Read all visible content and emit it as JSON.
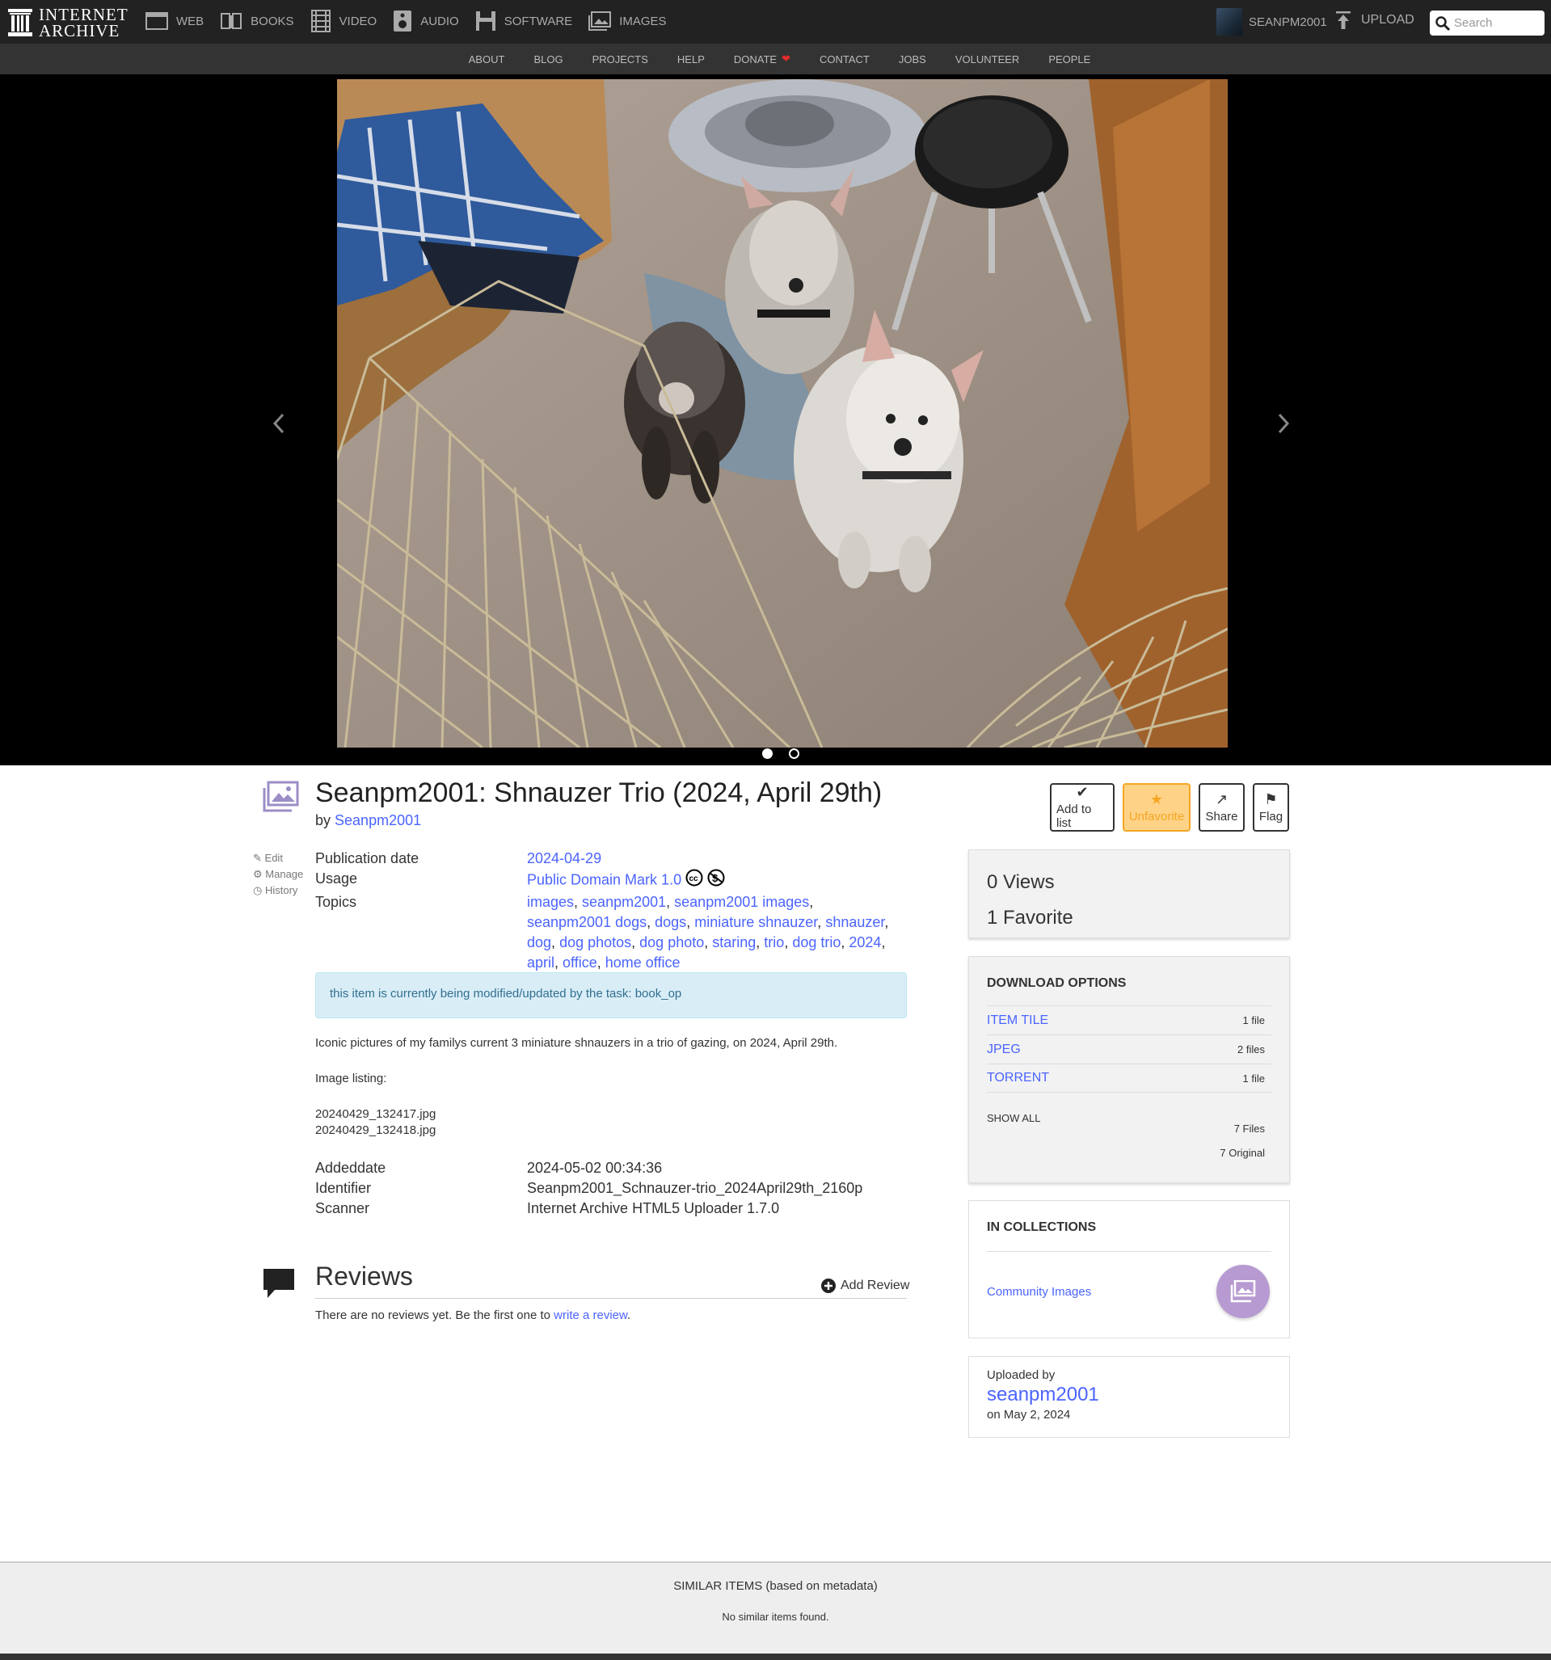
{
  "topbar": {
    "logo_line1": "INTERNET",
    "logo_line2": "ARCHIVE",
    "media": [
      {
        "label": "WEB",
        "icon": "web-icon"
      },
      {
        "label": "BOOKS",
        "icon": "books-icon"
      },
      {
        "label": "VIDEO",
        "icon": "video-icon"
      },
      {
        "label": "AUDIO",
        "icon": "audio-icon"
      },
      {
        "label": "SOFTWARE",
        "icon": "software-icon"
      },
      {
        "label": "IMAGES",
        "icon": "images-icon"
      }
    ],
    "username": "SEANPM2001",
    "upload_label": "UPLOAD",
    "search_placeholder": "Search"
  },
  "subnav": {
    "items": [
      "ABOUT",
      "BLOG",
      "PROJECTS",
      "HELP",
      "DONATE",
      "CONTACT",
      "JOBS",
      "VOLUNTEER",
      "PEOPLE"
    ]
  },
  "theatre": {
    "slide_count": 2,
    "active_slide": 1
  },
  "item": {
    "title": "Seanpm2001: Shnauzer Trio (2024, April 29th)",
    "by_prefix": "by",
    "creator": "Seanpm2001"
  },
  "actions": {
    "add_to_list": "Add to list",
    "unfavorite": "Unfavorite",
    "share": "Share",
    "flag": "Flag"
  },
  "tools": {
    "edit": "Edit",
    "manage": "Manage",
    "history": "History"
  },
  "metadata": {
    "publication_date_label": "Publication date",
    "publication_date": "2024-04-29",
    "usage_label": "Usage",
    "usage": "Public Domain Mark 1.0",
    "topics_label": "Topics",
    "topics": [
      "images",
      "seanpm2001",
      "seanpm2001 images",
      "seanpm2001 dogs",
      "dogs",
      "miniature shnauzer",
      "shnauzer",
      "dog",
      "dog photos",
      "dog photo",
      "staring",
      "trio",
      "dog trio",
      "2024",
      "april",
      "office",
      "home office"
    ],
    "notice": "this item is currently being modified/updated by the task: ",
    "notice_task": "book_op",
    "description": "Iconic pictures of my familys current 3 miniature shnauzers in a trio of gazing, on 2024, April 29th.",
    "image_listing_label": "Image listing:",
    "files": [
      "20240429_132417.jpg",
      "20240429_132418.jpg"
    ],
    "addeddate_label": "Addeddate",
    "addeddate": "2024-05-02 00:34:36",
    "identifier_label": "Identifier",
    "identifier": "Seanpm2001_Schnauzer-trio_2024April29th_2160p",
    "scanner_label": "Scanner",
    "scanner": "Internet Archive HTML5 Uploader 1.7.0"
  },
  "reviews": {
    "title": "Reviews",
    "add_label": "Add Review",
    "empty_text": "There are no reviews yet. Be the first one to ",
    "write_link": "write a review",
    "empty_end": "."
  },
  "stats": {
    "views": "0 Views",
    "favorites": "1 Favorite"
  },
  "downloads": {
    "title": "DOWNLOAD OPTIONS",
    "rows": [
      {
        "label": "ITEM TILE",
        "count": "1 file"
      },
      {
        "label": "JPEG",
        "count": "2 files"
      },
      {
        "label": "TORRENT",
        "count": "1 file"
      }
    ],
    "show_all": "SHOW ALL",
    "total_files": "7 Files",
    "total_original": "7 Original"
  },
  "collections": {
    "title": "IN COLLECTIONS",
    "items": [
      "Community Images"
    ]
  },
  "uploader": {
    "label": "Uploaded by",
    "name": "seanpm2001",
    "date": "on May 2, 2024"
  },
  "similar": {
    "title": "SIMILAR ITEMS (based on metadata)",
    "empty": "No similar items found."
  },
  "colors": {
    "link": "#4b64ff",
    "topbar": "#222222",
    "favorite": "#f5a623"
  }
}
